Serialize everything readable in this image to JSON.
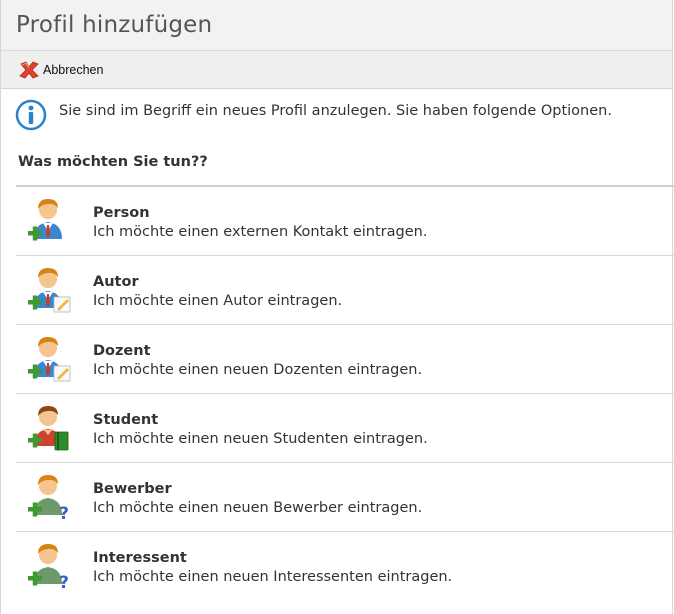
{
  "page": {
    "title": "Profil hinzufügen"
  },
  "toolbar": {
    "cancel_label": "Abbrechen",
    "cancel_icon": "red-x-icon"
  },
  "info": {
    "icon": "info-icon",
    "text": "Sie sind im Begriff ein neues Profil anzulegen. Sie haben folgende Optionen."
  },
  "question": "Was möchten Sie tun??",
  "options": [
    {
      "title": "Person",
      "desc": "Ich möchte einen externen Kontakt eintragen.",
      "icon": "person-add-icon"
    },
    {
      "title": "Autor",
      "desc": "Ich möchte einen Autor eintragen.",
      "icon": "author-add-icon"
    },
    {
      "title": "Dozent",
      "desc": "Ich möchte einen neuen Dozenten eintragen.",
      "icon": "lecturer-add-icon"
    },
    {
      "title": "Student",
      "desc": "Ich möchte einen neuen Studenten eintragen.",
      "icon": "student-add-icon"
    },
    {
      "title": "Bewerber",
      "desc": "Ich möchte einen neuen Bewerber eintragen.",
      "icon": "applicant-add-icon"
    },
    {
      "title": "Interessent",
      "desc": "Ich möchte einen neuen Interessenten eintragen.",
      "icon": "prospect-add-icon"
    }
  ],
  "colors": {
    "header_bg": "#f2f2f2",
    "toolbar_bg": "#efefef",
    "info_blue": "#2a82c8",
    "plus_green": "#3e9a2e",
    "cancel_red": "#e0452c"
  }
}
